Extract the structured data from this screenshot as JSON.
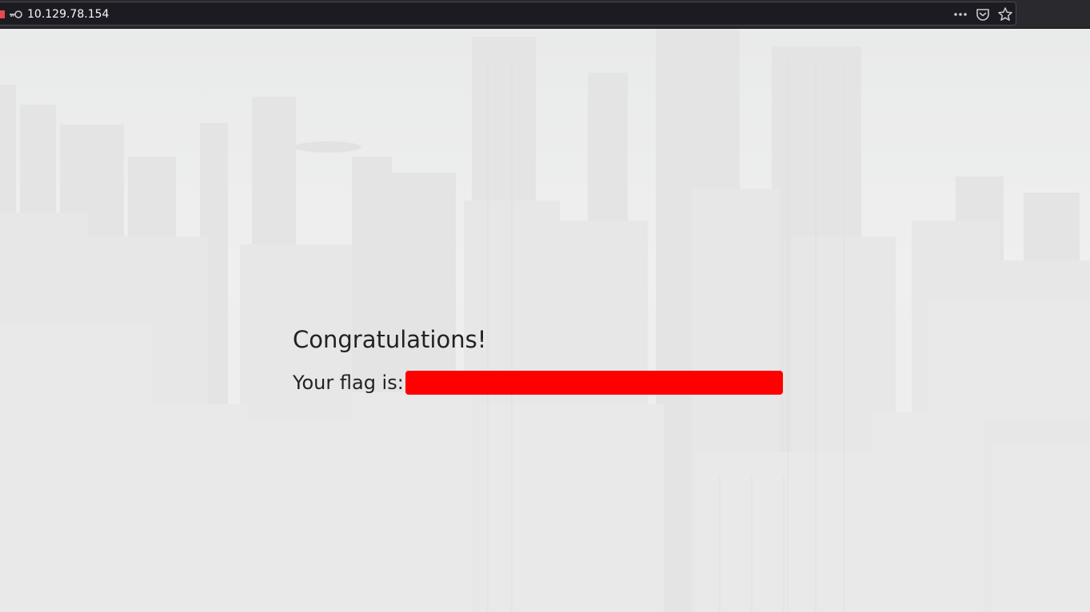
{
  "browser": {
    "url": "10.129.78.154",
    "icons": [
      "site-icon",
      "key-icon",
      "more-dots-icon",
      "pocket-icon",
      "bookmark-star-icon"
    ]
  },
  "page": {
    "heading": "Congratulations!",
    "flag_label": "Your flag is:",
    "flag_redaction_color": "#ff0000",
    "background_image": "city-skyline-photo"
  }
}
